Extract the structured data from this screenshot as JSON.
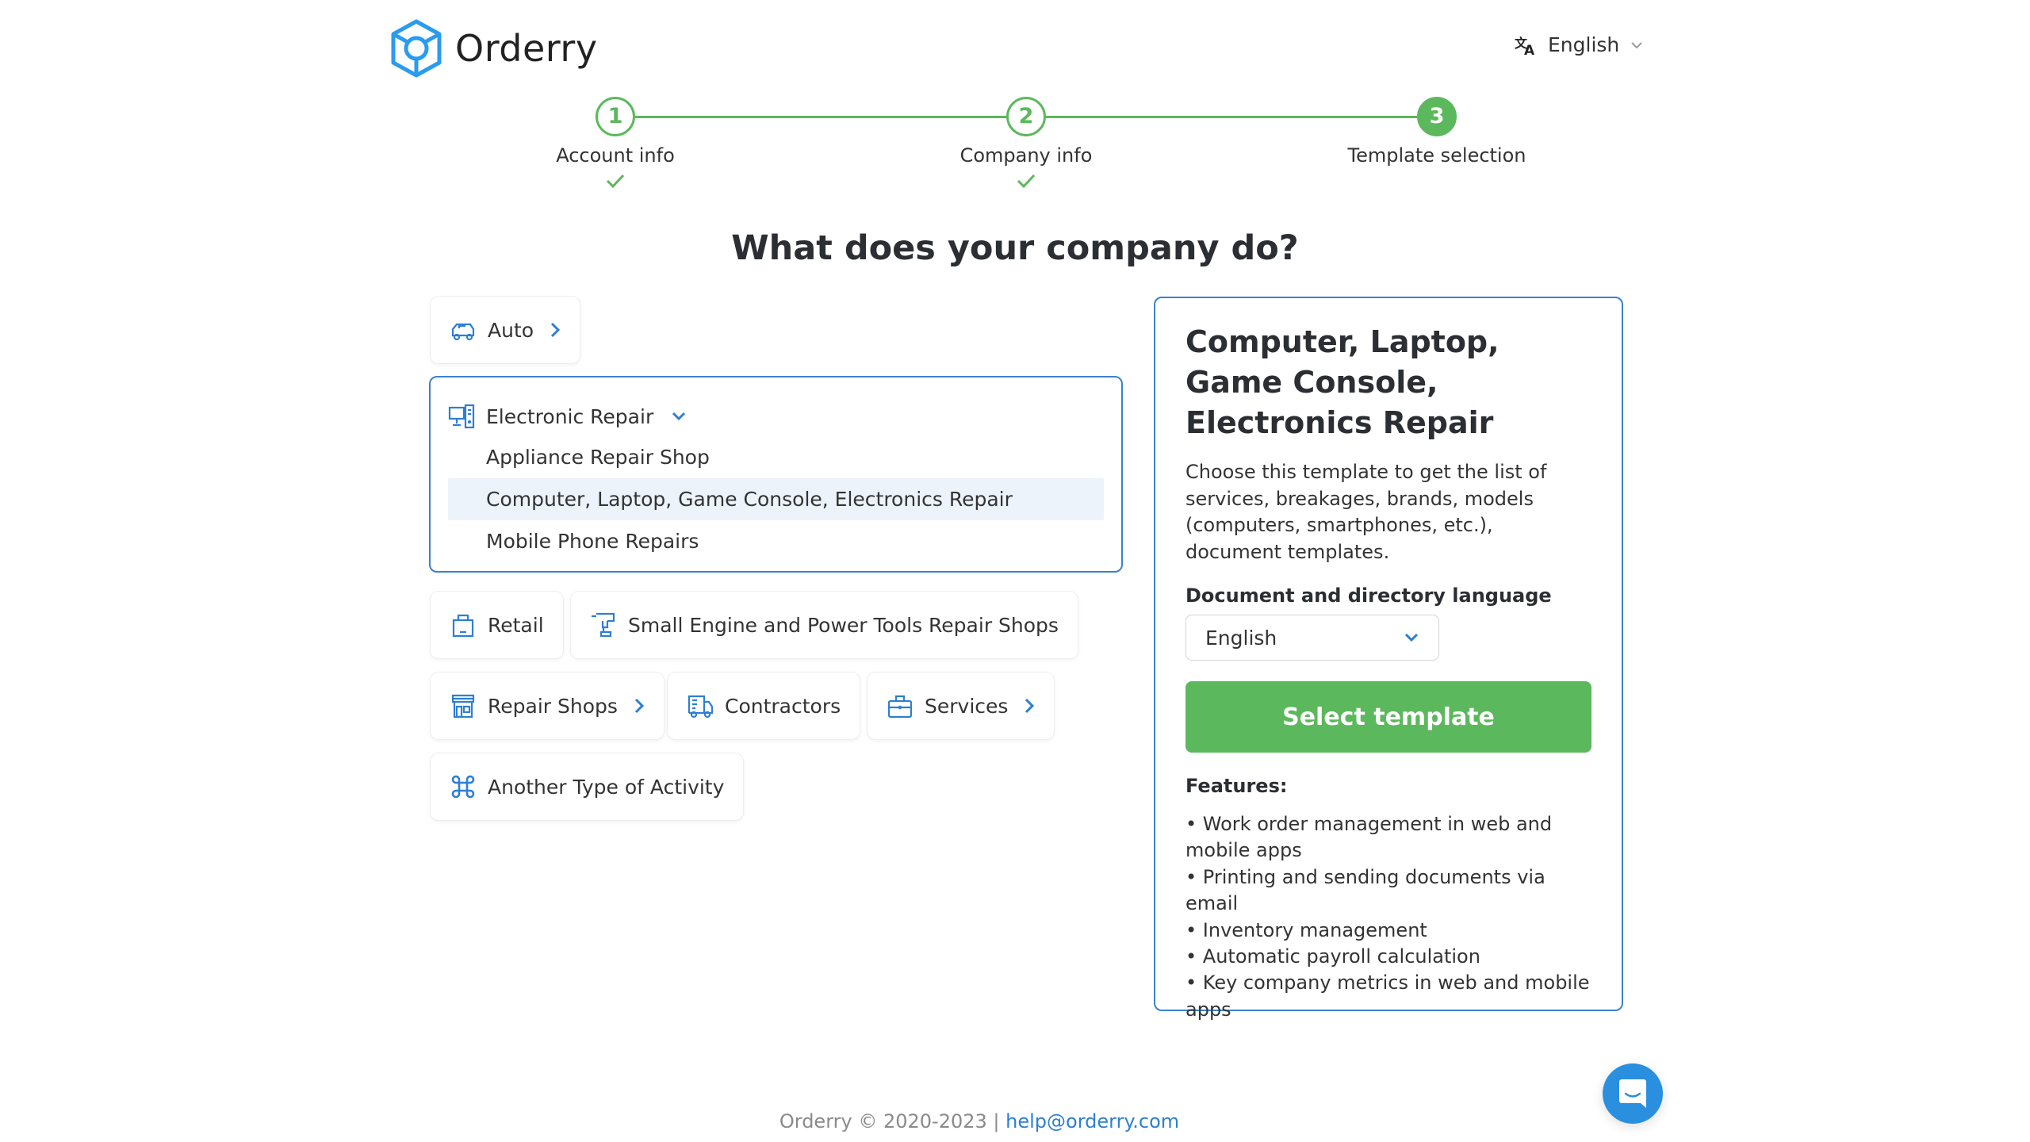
{
  "header": {
    "brand": "Orderry",
    "language": "English"
  },
  "stepper": {
    "steps": [
      {
        "number": "1",
        "label": "Account info",
        "status": "completed"
      },
      {
        "number": "2",
        "label": "Company info",
        "status": "completed"
      },
      {
        "number": "3",
        "label": "Template selection",
        "status": "active"
      }
    ]
  },
  "main": {
    "title": "What does your company do?"
  },
  "categories": {
    "auto": {
      "label": "Auto",
      "icon": "car-icon",
      "has_submenu": true
    },
    "electronic_repair": {
      "label": "Electronic Repair",
      "icon": "computer-icon",
      "expanded": true,
      "items": [
        {
          "label": "Appliance Repair Shop",
          "selected": false
        },
        {
          "label": "Computer, Laptop, Game Console, Electronics Repair",
          "selected": true
        },
        {
          "label": "Mobile Phone Repairs",
          "selected": false
        }
      ]
    },
    "retail": {
      "label": "Retail",
      "icon": "shopping-bag-icon",
      "has_submenu": false
    },
    "small_engine": {
      "label": "Small Engine and Power Tools Repair Shops",
      "icon": "drill-icon",
      "has_submenu": false
    },
    "repair_shops": {
      "label": "Repair Shops",
      "icon": "storefront-icon",
      "has_submenu": true
    },
    "contractors": {
      "label": "Contractors",
      "icon": "truck-icon",
      "has_submenu": false
    },
    "services": {
      "label": "Services",
      "icon": "briefcase-icon",
      "has_submenu": true
    },
    "another": {
      "label": "Another Type of Activity",
      "icon": "command-icon",
      "has_submenu": false
    }
  },
  "template_card": {
    "title": "Computer, Laptop, Game Console, Electronics Repair",
    "description": "Choose this template to get the list of services, breakages, brands, models (computers, smartphones, etc.), document templates.",
    "language_label": "Document and directory language",
    "language_value": "English",
    "select_button": "Select template",
    "features_title": "Features:",
    "features": [
      "• Work order management in web and mobile apps",
      "• Printing and sending documents via email",
      "• Inventory management",
      "• Automatic payroll calculation",
      "• Key company metrics in web and mobile apps"
    ]
  },
  "footer": {
    "copyright": "Orderry © 2020-2023 | ",
    "email": "help@orderry.com"
  },
  "colors": {
    "brand_blue": "#2a8fde",
    "accent_green": "#5cb85c",
    "border_blue": "#3b82d0",
    "selected_bg": "#ecf3fa"
  }
}
